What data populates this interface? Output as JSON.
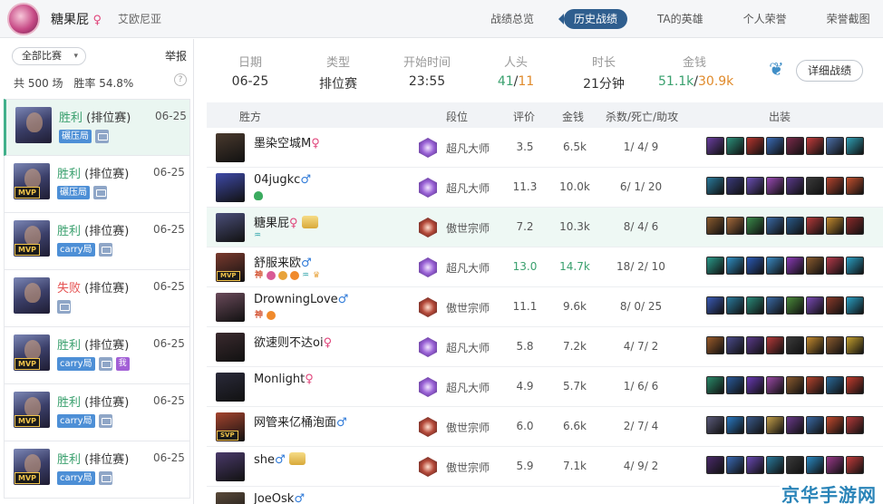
{
  "header": {
    "username": "糖果屁",
    "gender_symbol": "♀",
    "server": "艾欧尼亚",
    "nav": [
      "战绩总览",
      "历史战绩",
      "TA的英雄",
      "个人荣誉",
      "荣誉截图"
    ],
    "active_nav": "历史战绩"
  },
  "sidebar": {
    "filter_label": "全部比赛",
    "report_label": "举报",
    "total": "共 500 场",
    "winrate": "胜率 54.8%",
    "help": "?",
    "matches": [
      {
        "result": "胜利",
        "type": "(排位赛)",
        "date": "06-25",
        "tag": "碾压局",
        "mvp": "",
        "win": true
      },
      {
        "result": "胜利",
        "type": "(排位赛)",
        "date": "06-25",
        "tag": "碾压局",
        "mvp": "MVP",
        "win": true
      },
      {
        "result": "胜利",
        "type": "(排位赛)",
        "date": "06-25",
        "tag": "carry局",
        "mvp": "MVP",
        "win": true
      },
      {
        "result": "失败",
        "type": "(排位赛)",
        "date": "06-25",
        "tag": "",
        "mvp": "",
        "win": false
      },
      {
        "result": "胜利",
        "type": "(排位赛)",
        "date": "06-25",
        "tag": "carry局",
        "mvp": "MVP",
        "win": true,
        "extra": "我"
      },
      {
        "result": "胜利",
        "type": "(排位赛)",
        "date": "06-25",
        "tag": "carry局",
        "mvp": "MVP",
        "win": true
      },
      {
        "result": "胜利",
        "type": "(排位赛)",
        "date": "06-25",
        "tag": "carry局",
        "mvp": "MVP",
        "win": true
      }
    ]
  },
  "summary": {
    "date_label": "日期",
    "date": "06-25",
    "type_label": "类型",
    "type": "排位赛",
    "start_label": "开始时间",
    "start": "23:55",
    "kills_label": "人头",
    "kills_a": "41",
    "kills_b": "11",
    "duration_label": "时长",
    "duration": "21分钟",
    "gold_label": "金钱",
    "gold_a": "51.1k",
    "gold_b": "30.9k",
    "detail_button": "详细战绩"
  },
  "table": {
    "headers": {
      "side": "胜方",
      "rank": "段位",
      "score": "评价",
      "gold": "金钱",
      "kda": "杀数/死亡/助攻",
      "items": "出装"
    },
    "rows": [
      {
        "name": "墨染空城M",
        "gender": "♀",
        "rank": "超凡大师",
        "rank_type": "master",
        "score": "3.5",
        "gold": "6.5k",
        "kda": "1/ 4/ 9",
        "mvp": "",
        "color": "#4a3a2e",
        "badges": [],
        "items": [
          "#6a3ea0",
          "#2b8f7a",
          "#b5352e",
          "#3a6bb5",
          "#7a2a4a",
          "#c43c3c",
          "#4b6fa8",
          "#2f9fb5"
        ]
      },
      {
        "name": "04jugkc",
        "gender": "♂",
        "rank": "超凡大师",
        "rank_type": "master",
        "score": "11.3",
        "gold": "10.0k",
        "kda": "6/ 1/ 20",
        "mvp": "",
        "color": "#3f4aa8",
        "badges": [
          "shield"
        ],
        "items": [
          "#2a7a9c",
          "#3a3a7a",
          "#6b4fb5",
          "#9a4ab5",
          "#5a3a8a",
          "#3a3a3a",
          "#b5442e",
          "#c4502e"
        ]
      },
      {
        "name": "糖果屁",
        "gender": "♀",
        "rank": "傲世宗师",
        "rank_type": "gm",
        "score": "7.2",
        "gold": "10.3k",
        "kda": "8/ 4/ 6",
        "mvp": "",
        "color": "#4b4f7a",
        "honor": true,
        "badges": [
          "teal"
        ],
        "items": [
          "#8a5a2e",
          "#a56a3a",
          "#3a8a4a",
          "#3a6aa5",
          "#2a5a8a",
          "#b53a3a",
          "#c48a2e",
          "#8a2a2a"
        ]
      },
      {
        "name": "舒服来欧",
        "gender": "♂",
        "rank": "超凡大师",
        "rank_type": "master",
        "score": "13.0",
        "gold": "14.7k",
        "kda": "18/ 2/ 10",
        "mvp": "MVP",
        "color": "#7a3a2e",
        "badges": [
          "text",
          "pink",
          "gold",
          "orange",
          "teal",
          "crown"
        ],
        "items": [
          "#2a9a8a",
          "#2f8fc4",
          "#2a5ab5",
          "#3a8ac4",
          "#8a3ab5",
          "#8a5a2e",
          "#b53a4a",
          "#2a9fc4"
        ],
        "highlight": true
      },
      {
        "name": "DrowningLove",
        "gender": "♂",
        "rank": "傲世宗师",
        "rank_type": "gm",
        "score": "11.1",
        "gold": "9.6k",
        "kda": "8/ 0/ 25",
        "mvp": "",
        "color": "#6a4a5a",
        "badges": [
          "text",
          "orange"
        ],
        "items": [
          "#3a5ab5",
          "#2a7a9c",
          "#2a8a7a",
          "#3a6aa5",
          "#4a8a3a",
          "#7a4ab5",
          "#8a3a2a",
          "#2a9fc4"
        ]
      },
      {
        "name": "欲速则不达oi",
        "gender": "♀",
        "rank": "超凡大师",
        "rank_type": "master",
        "score": "5.8",
        "gold": "7.2k",
        "kda": "4/ 7/ 2",
        "mvp": "",
        "color": "#3a2a2e",
        "badges": [],
        "items": [
          "#9a5a2a",
          "#4a4a8a",
          "#5a3a8a",
          "#b53a3a",
          "#3a3a3a",
          "#c48a2e",
          "#8a5a2e",
          "#c4a02e"
        ]
      },
      {
        "name": "Monlight",
        "gender": "♀",
        "rank": "超凡大师",
        "rank_type": "master",
        "score": "4.9",
        "gold": "5.7k",
        "kda": "1/ 6/ 6",
        "mvp": "",
        "color": "#2a2a3a",
        "badges": [],
        "items": [
          "#2a8a6a",
          "#2a5a9a",
          "#6a3ab5",
          "#9a4aa5",
          "#8a5a2e",
          "#b5442e",
          "#2a6a9a",
          "#c43c2e"
        ]
      },
      {
        "name": "网管来亿桶泡面",
        "gender": "♂",
        "rank": "傲世宗师",
        "rank_type": "gm",
        "score": "6.0",
        "gold": "6.6k",
        "kda": "2/ 7/ 4",
        "mvp": "SVP",
        "color": "#a5442e",
        "badges": [],
        "items": [
          "#5a5a7a",
          "#2a7ac4",
          "#3a5a8a",
          "#c4a04a",
          "#6a3a8a",
          "#3a6aa5",
          "#c44a2e",
          "#b53a3a"
        ]
      },
      {
        "name": "she",
        "gender": "♂",
        "rank": "傲世宗师",
        "rank_type": "gm",
        "score": "5.9",
        "gold": "7.1k",
        "kda": "4/ 9/ 2",
        "mvp": "",
        "color": "#4a3a6a",
        "honor": true,
        "badges": [],
        "items": [
          "#4a2a6a",
          "#3a6ab5",
          "#6a4ab5",
          "#2a7a9c",
          "#3a3a3a",
          "#2a8ac4",
          "#9a3a8a",
          "#c43c3c"
        ]
      },
      {
        "name": "JoeOsk",
        "gender": "♂",
        "rank": "",
        "rank_type": "gm",
        "score": "",
        "gold": "",
        "kda": "",
        "mvp": "",
        "color": "#5a4a3a",
        "badges": [],
        "items": []
      }
    ]
  },
  "watermark": "京华手游网"
}
